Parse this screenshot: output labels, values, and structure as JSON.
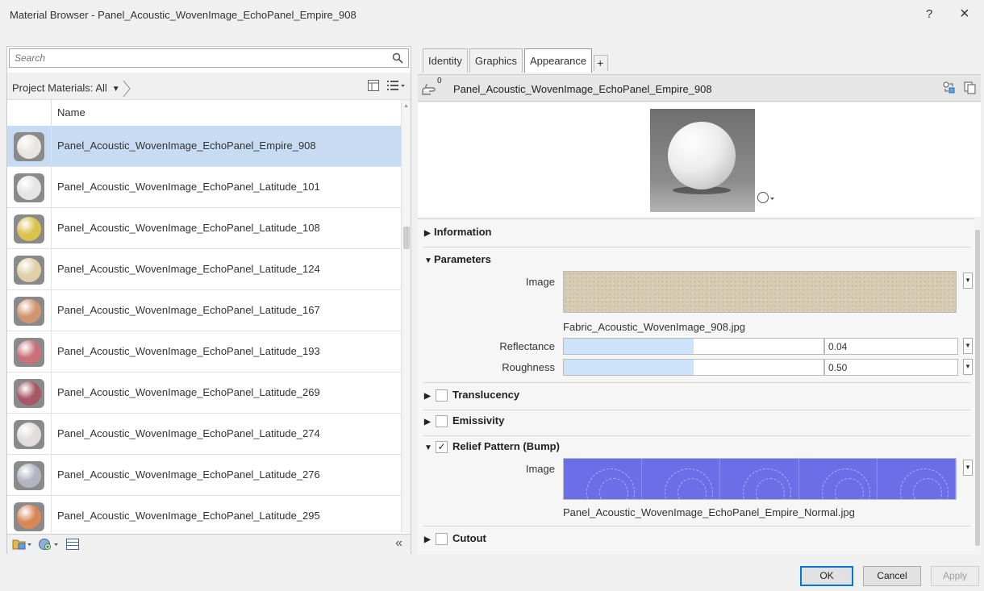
{
  "window": {
    "title": "Material Browser - Panel_Acoustic_WovenImage_EchoPanel_Empire_908",
    "help": "?",
    "close": "×"
  },
  "left": {
    "search_placeholder": "Search",
    "filter_label": "Project Materials: All",
    "column_header": "Name",
    "collapse": "«",
    "materials": [
      {
        "name": "Panel_Acoustic_WovenImage_EchoPanel_Empire_908",
        "color": "#e9e6df",
        "selected": true
      },
      {
        "name": "Panel_Acoustic_WovenImage_EchoPanel_Latitude_101",
        "color": "#e5e5e5",
        "selected": false
      },
      {
        "name": "Panel_Acoustic_WovenImage_EchoPanel_Latitude_108",
        "color": "#d9c24e",
        "selected": false
      },
      {
        "name": "Panel_Acoustic_WovenImage_EchoPanel_Latitude_124",
        "color": "#e0cfa9",
        "selected": false
      },
      {
        "name": "Panel_Acoustic_WovenImage_EchoPanel_Latitude_167",
        "color": "#d19670",
        "selected": false
      },
      {
        "name": "Panel_Acoustic_WovenImage_EchoPanel_Latitude_193",
        "color": "#c9717a",
        "selected": false
      },
      {
        "name": "Panel_Acoustic_WovenImage_EchoPanel_Latitude_269",
        "color": "#a85764",
        "selected": false
      },
      {
        "name": "Panel_Acoustic_WovenImage_EchoPanel_Latitude_274",
        "color": "#e2dcdc",
        "selected": false
      },
      {
        "name": "Panel_Acoustic_WovenImage_EchoPanel_Latitude_276",
        "color": "#b1b5c4",
        "selected": false
      },
      {
        "name": "Panel_Acoustic_WovenImage_EchoPanel_Latitude_295",
        "color": "#d98658",
        "selected": false
      }
    ]
  },
  "right": {
    "tabs": [
      {
        "label": "Identity",
        "active": false
      },
      {
        "label": "Graphics",
        "active": false
      },
      {
        "label": "Appearance",
        "active": true
      }
    ],
    "add_tab": "+",
    "header_count": "0",
    "material_name": "Panel_Acoustic_WovenImage_EchoPanel_Empire_908",
    "sections": {
      "information": "Information",
      "parameters": "Parameters",
      "translucency": "Translucency",
      "emissivity": "Emissivity",
      "relief": "Relief Pattern (Bump)",
      "cutout": "Cutout"
    },
    "parameters": {
      "image_label": "Image",
      "image_file": "Fabric_Acoustic_WovenImage_908.jpg",
      "reflectance_label": "Reflectance",
      "reflectance_value": "0.04",
      "reflectance_fraction": 0.04,
      "roughness_label": "Roughness",
      "roughness_value": "0.50",
      "roughness_fraction": 0.5
    },
    "relief": {
      "checked": true,
      "check_mark": "✓",
      "image_label": "Image",
      "image_file": "Panel_Acoustic_WovenImage_EchoPanel_Empire_Normal.jpg"
    }
  },
  "footer": {
    "ok": "OK",
    "cancel": "Cancel",
    "apply": "Apply"
  }
}
